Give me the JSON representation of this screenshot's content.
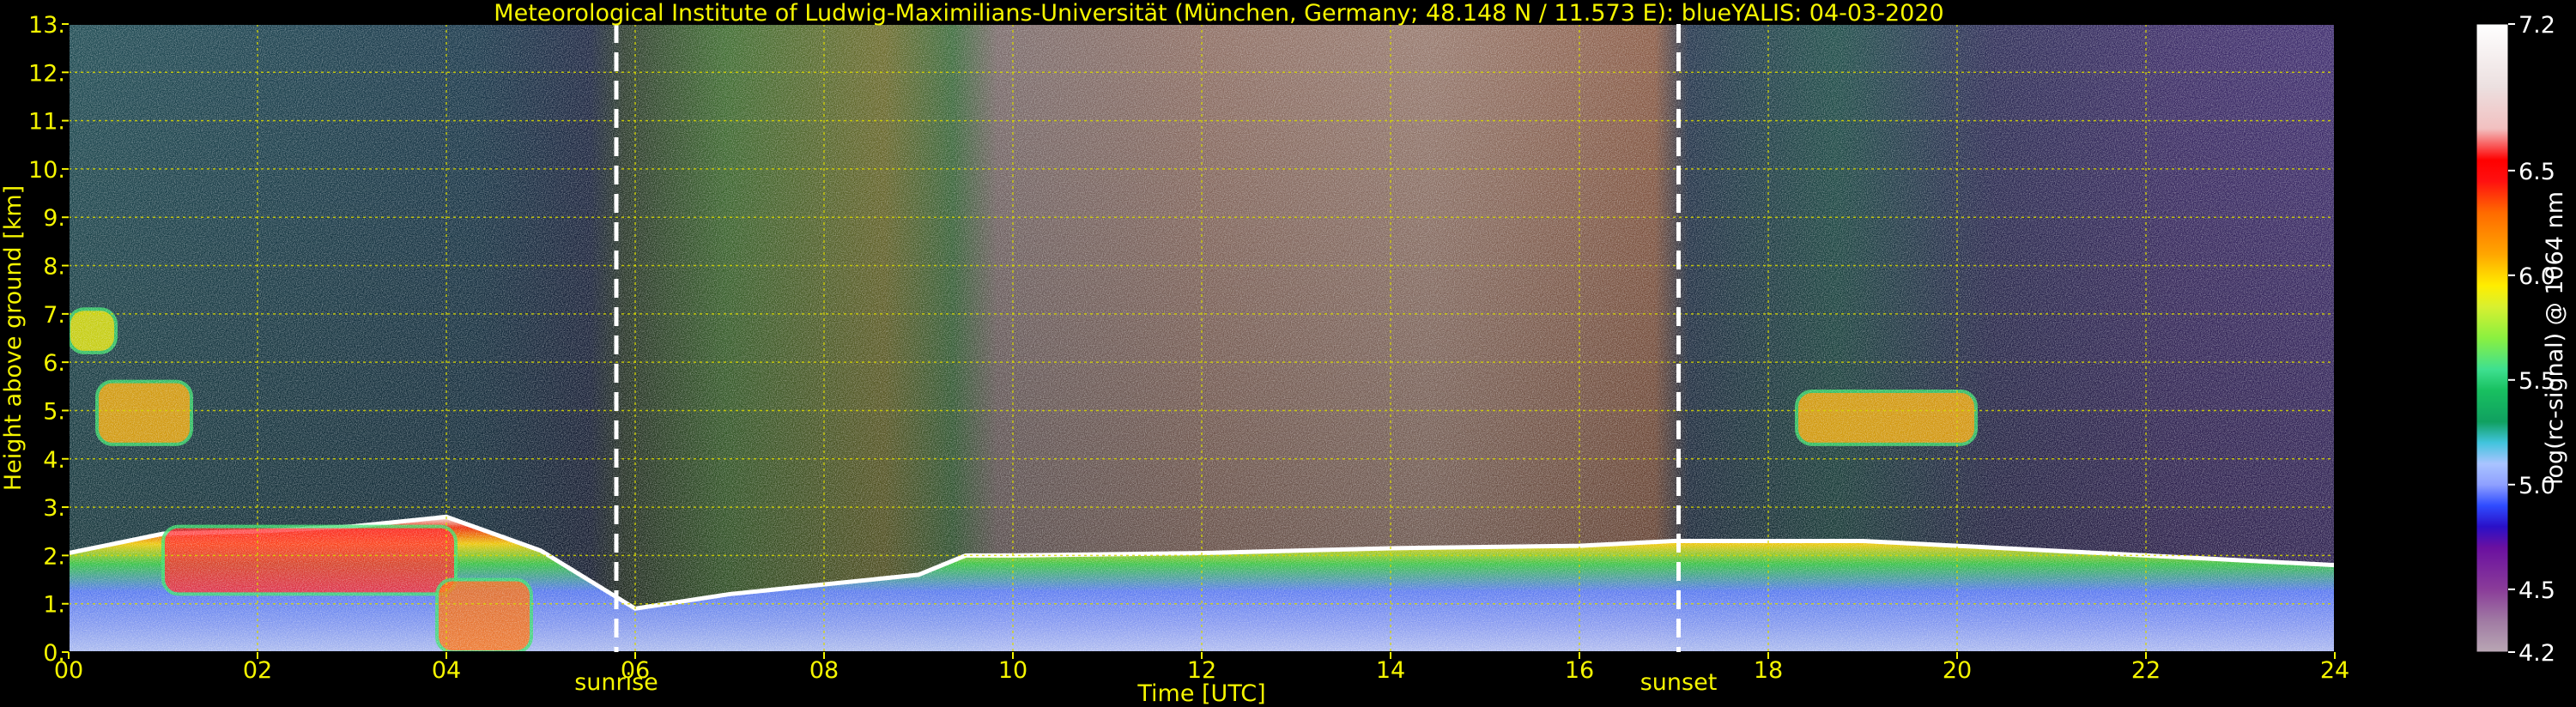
{
  "chart_data": {
    "type": "heatmap",
    "title": "Meteorological Institute of Ludwig-Maximilians-Universität (München, Germany; 48.148 N / 11.573 E):    blueYALIS: 04-03-2020",
    "xlabel": "Time [UTC]",
    "ylabel": "Height above ground [km]",
    "xlim": [
      0,
      24
    ],
    "ylim": [
      0,
      13
    ],
    "xticks": [
      0,
      2,
      4,
      6,
      8,
      10,
      12,
      14,
      16,
      18,
      20,
      22,
      24
    ],
    "xtick_labels": [
      "00",
      "02",
      "04",
      "06",
      "08",
      "10",
      "12",
      "14",
      "16",
      "18",
      "20",
      "22",
      "24"
    ],
    "yticks": [
      0,
      1,
      2,
      3,
      4,
      5,
      6,
      7,
      8,
      9,
      10,
      11,
      12,
      13
    ],
    "ytick_labels": [
      "0.",
      "1.",
      "2.",
      "3.",
      "4.",
      "5.",
      "6.",
      "7.",
      "8.",
      "9.",
      "10.",
      "11.",
      "12.",
      "13."
    ],
    "grid": true,
    "sun_events": [
      {
        "label": "sunrise",
        "time": 5.8
      },
      {
        "label": "sunset",
        "time": 17.05
      }
    ],
    "colorbar": {
      "label": "log(rc-signal) @ 1064 nm",
      "range": [
        4.2,
        7.2
      ],
      "tick_values": [
        4.2,
        4.5,
        5.0,
        5.5,
        6.0,
        6.5,
        7.2
      ],
      "tick_labels": [
        "4.2",
        "4.5",
        "5.0",
        "5.5",
        "6.0",
        "6.5",
        "7.2"
      ]
    },
    "features": {
      "boundary_layer_top": [
        [
          0,
          2.05
        ],
        [
          1,
          2.45
        ],
        [
          2,
          2.5
        ],
        [
          3,
          2.6
        ],
        [
          4,
          2.8
        ],
        [
          5,
          2.1
        ],
        [
          6,
          0.9
        ],
        [
          7,
          1.2
        ],
        [
          8,
          1.4
        ],
        [
          9,
          1.6
        ],
        [
          9.5,
          2.0
        ],
        [
          10,
          2.0
        ],
        [
          12,
          2.05
        ],
        [
          14,
          2.15
        ],
        [
          16,
          2.2
        ],
        [
          17,
          2.3
        ],
        [
          18,
          2.3
        ],
        [
          19,
          2.3
        ],
        [
          20,
          2.2
        ],
        [
          22,
          2.0
        ],
        [
          24,
          1.8
        ]
      ],
      "cloud_layers": [
        {
          "t_start": 0.0,
          "t_end": 0.5,
          "h_low": 6.2,
          "h_high": 7.1,
          "value": 6.0
        },
        {
          "t_start": 0.3,
          "t_end": 1.3,
          "h_low": 4.3,
          "h_high": 5.6,
          "value": 6.3
        },
        {
          "t_start": 1.0,
          "t_end": 4.1,
          "h_low": 1.2,
          "h_high": 2.6,
          "value": 6.7
        },
        {
          "t_start": 3.9,
          "t_end": 4.9,
          "h_low": 0.0,
          "h_high": 1.5,
          "value": 6.5
        },
        {
          "t_start": 18.3,
          "t_end": 20.2,
          "h_low": 4.3,
          "h_high": 5.4,
          "value": 6.2
        }
      ]
    }
  }
}
